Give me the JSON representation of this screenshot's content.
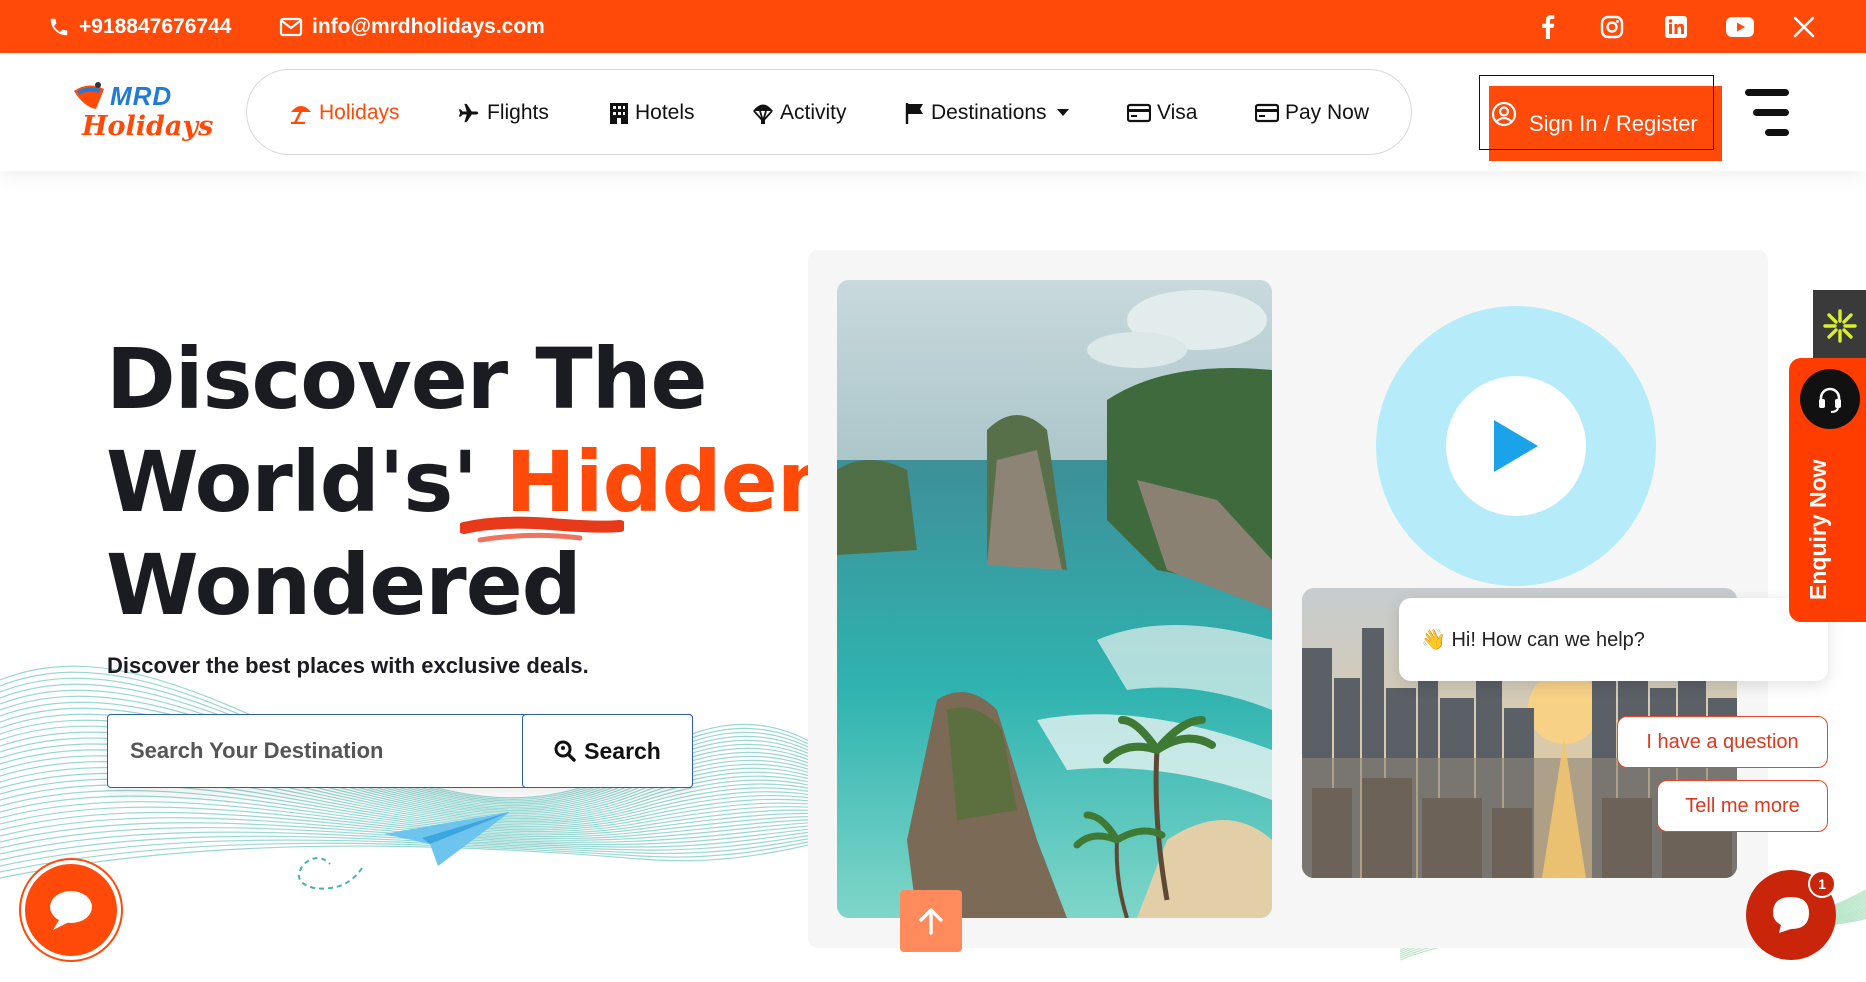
{
  "topbar": {
    "phone": "+918847676744",
    "email": "info@mrdholidays.com",
    "socials": [
      "facebook-icon",
      "instagram-icon",
      "linkedin-icon",
      "youtube-icon",
      "x-icon"
    ]
  },
  "brand": {
    "line1": "MRD",
    "line2": "Holidays"
  },
  "nav": {
    "items": [
      {
        "label": "Holidays",
        "icon": "beach-umbrella-icon",
        "active": true
      },
      {
        "label": "Flights",
        "icon": "plane-icon"
      },
      {
        "label": "Hotels",
        "icon": "building-icon"
      },
      {
        "label": "Activity",
        "icon": "parachute-icon"
      },
      {
        "label": "Destinations",
        "icon": "flag-icon",
        "dropdown": true
      },
      {
        "label": "Visa",
        "icon": "card-icon"
      },
      {
        "label": "Pay Now",
        "icon": "card-icon"
      }
    ],
    "signin": "Sign In / Register"
  },
  "hero": {
    "title_line1": "Discover The",
    "title_line2a": "World's'",
    "title_line2b": "Hidden",
    "title_line3": "Wondered",
    "subtitle": "Discover the best places with exclusive deals.",
    "search_placeholder": "Search Your Destination",
    "search_button": "Search"
  },
  "chat": {
    "greeting": "👋 Hi! How can we help?",
    "option1": "I have a question",
    "option2": "Tell me more",
    "badge": "1"
  },
  "enquiry": {
    "label": "Enquiry Now"
  },
  "colors": {
    "accent": "#ff4a0a",
    "dark": "#1b1b22",
    "play": "#1aa3e8"
  }
}
